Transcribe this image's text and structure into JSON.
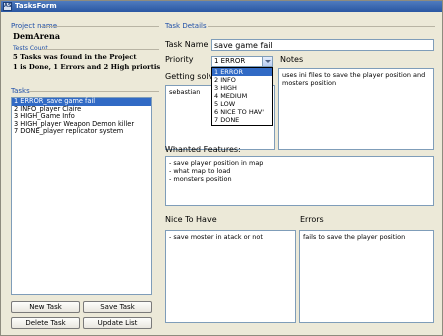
{
  "window": {
    "title": "TasksForm",
    "icon_label": "ASP"
  },
  "project": {
    "group_label": "Project name",
    "name": "DemArena"
  },
  "tests_count": {
    "group_label": "Tests Count",
    "line1": "5 Tasks was found in the Project",
    "line2": "1 is Done, 1 Errors and 2 High priortis"
  },
  "tasks": {
    "group_label": "Tasks",
    "items": [
      {
        "label": "1 ERROR_save game fail",
        "selected": true
      },
      {
        "label": "2 INFO_player Claire",
        "selected": false
      },
      {
        "label": "3 HIGH_Game Info",
        "selected": false
      },
      {
        "label": "3 HIGH_player Weapon Demon killer",
        "selected": false
      },
      {
        "label": "7 DONE_player replicator system",
        "selected": false
      }
    ]
  },
  "buttons": {
    "new_task": "New Task",
    "save_task": "Save Task",
    "delete_task": "Delete Task",
    "update_list": "Update List"
  },
  "details": {
    "group_label": "Task Details",
    "task_name_label": "Task Name",
    "task_name_value": "save game fail",
    "priority_label": "Priority",
    "priority_value": "1 ERROR",
    "priority_options": [
      {
        "label": "1 ERROR",
        "selected": true
      },
      {
        "label": "2 INFO",
        "selected": false
      },
      {
        "label": "3 HIGH",
        "selected": false
      },
      {
        "label": "4 MEDIUM",
        "selected": false
      },
      {
        "label": "5 LOW",
        "selected": false
      },
      {
        "label": "6 NICE TO HAV'",
        "selected": false
      },
      {
        "label": "7 DONE",
        "selected": false
      }
    ],
    "getting_solver_label": "Getting solve",
    "getting_solver_value": "sebastian",
    "notes_label": "Notes",
    "notes_lines": [
      "uses ini files to save the player position and",
      "mosters position"
    ],
    "wanted_label": "Whanted Features:",
    "wanted_lines": [
      "- save player position in map",
      "- what map to load",
      "- monsters position"
    ],
    "nice_label": "Nice To Have",
    "nice_lines": [
      "- save moster in atack or not"
    ],
    "errors_label": "Errors",
    "errors_lines": [
      "fails to save the player position"
    ]
  }
}
